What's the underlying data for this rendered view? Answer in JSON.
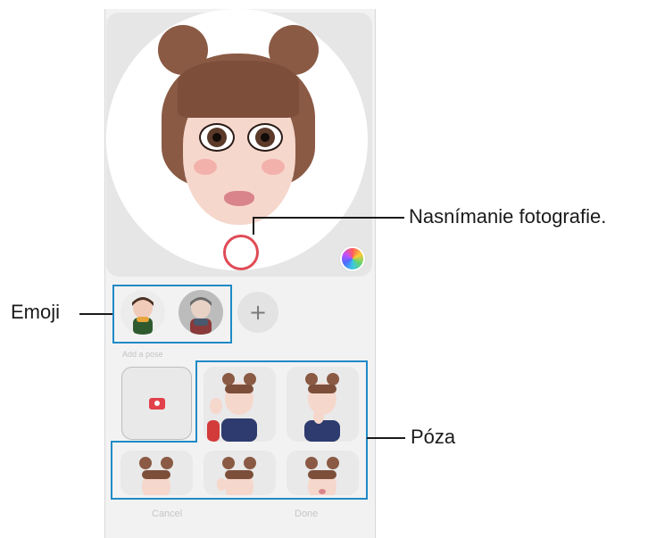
{
  "camera": {
    "shutter_icon": "shutter-button",
    "color_icon": "color-palette-icon",
    "accent_color": "#e04b55"
  },
  "emoji_row": {
    "add_label": "+",
    "items": [
      "emoji-boy",
      "emoji-girl"
    ]
  },
  "pose_section": {
    "label": "Add a pose",
    "poses": [
      "pose-wave",
      "pose-thinking",
      "pose-squint",
      "pose-peace",
      "pose-kiss"
    ]
  },
  "bottom": {
    "cancel_label": "Cancel",
    "done_label": "Done"
  },
  "callouts": {
    "capture": "Nasnímanie fotografie.",
    "emoji": "Emoji",
    "pose": "Póza"
  },
  "colors": {
    "callout_box": "#1f8ac7",
    "callout_line": "#1a1a1a"
  }
}
